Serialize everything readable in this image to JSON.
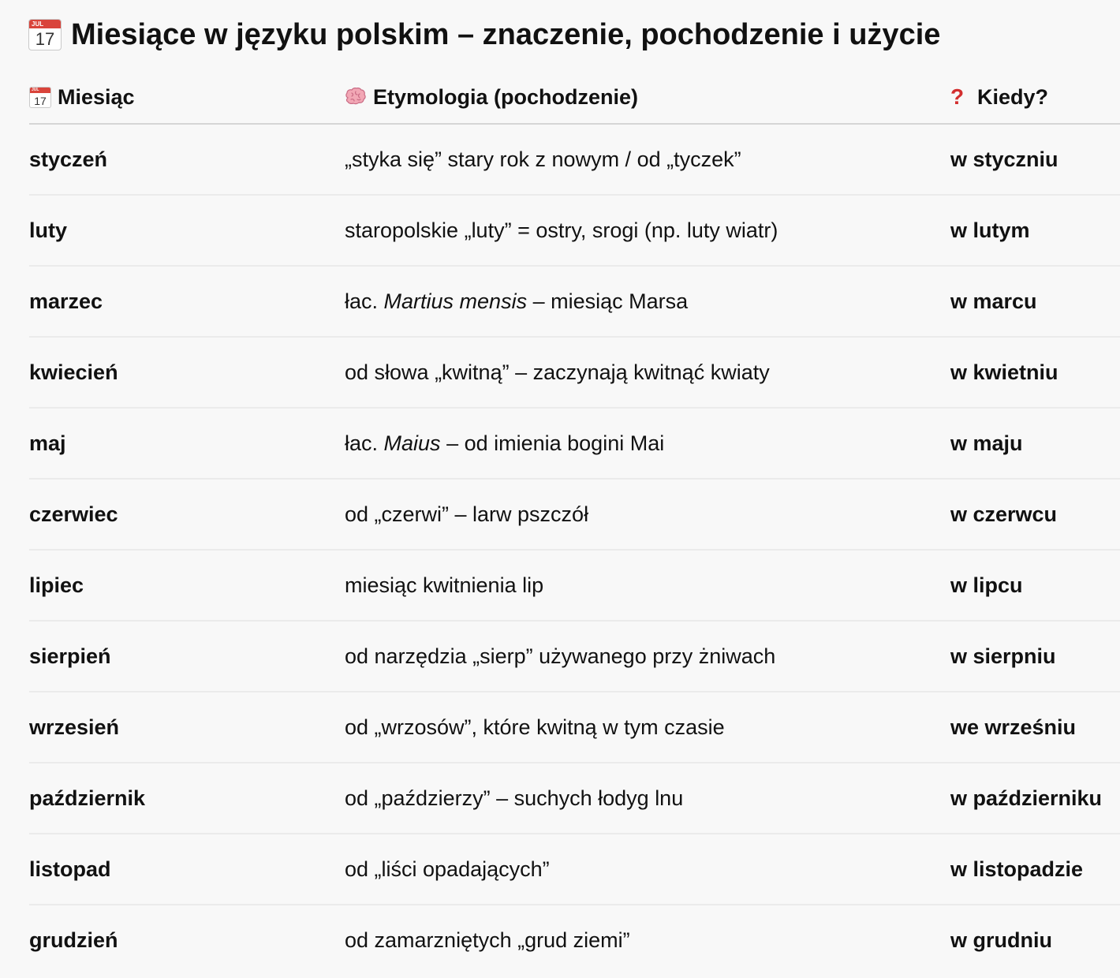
{
  "title": {
    "icon": "calendar-icon",
    "text": "Miesiące w języku polskim – znaczenie, pochodzenie i użycie",
    "calendar_month": "JUL",
    "calendar_day": "17"
  },
  "table": {
    "headers": [
      {
        "icon": "calendar-icon",
        "label": "Miesiąc"
      },
      {
        "icon": "brain-icon",
        "label": "Etymologia (pochodzenie)"
      },
      {
        "icon": "red-question-mark-icon",
        "label": "Kiedy?"
      }
    ],
    "rows": [
      {
        "month": "styczeń",
        "etymology": [
          {
            "text": "„styka się” stary rok z nowym / od „tyczek”"
          }
        ],
        "when": "w styczniu"
      },
      {
        "month": "luty",
        "etymology": [
          {
            "text": "staropolskie „luty” = ostry, srogi (np. luty wiatr)"
          }
        ],
        "when": "w lutym"
      },
      {
        "month": "marzec",
        "etymology": [
          {
            "text": "łac. "
          },
          {
            "text": "Martius mensis",
            "italic": true
          },
          {
            "text": " – miesiąc Marsa"
          }
        ],
        "when": "w marcu"
      },
      {
        "month": "kwiecień",
        "etymology": [
          {
            "text": "od słowa „kwitną” – zaczynają kwitnąć kwiaty"
          }
        ],
        "when": "w kwietniu"
      },
      {
        "month": "maj",
        "etymology": [
          {
            "text": "łac. "
          },
          {
            "text": "Maius",
            "italic": true
          },
          {
            "text": " – od imienia bogini Mai"
          }
        ],
        "when": "w maju"
      },
      {
        "month": "czerwiec",
        "etymology": [
          {
            "text": "od „czerwi” – larw pszczół"
          }
        ],
        "when": "w czerwcu"
      },
      {
        "month": "lipiec",
        "etymology": [
          {
            "text": "miesiąc kwitnienia lip"
          }
        ],
        "when": "w lipcu"
      },
      {
        "month": "sierpień",
        "etymology": [
          {
            "text": "od narzędzia „sierp” używanego przy żniwach"
          }
        ],
        "when": "w sierpniu"
      },
      {
        "month": "wrzesień",
        "etymology": [
          {
            "text": "od „wrzosów”, które kwitną w tym czasie"
          }
        ],
        "when": "we wrześniu"
      },
      {
        "month": "październik",
        "etymology": [
          {
            "text": "od „paździerzy” – suchych łodyg lnu"
          }
        ],
        "when": "w październiku"
      },
      {
        "month": "listopad",
        "etymology": [
          {
            "text": "od „liści opadających”"
          }
        ],
        "when": "w listopadzie"
      },
      {
        "month": "grudzień",
        "etymology": [
          {
            "text": "od zamarzniętych „grud ziemi”"
          }
        ],
        "when": "w grudniu"
      }
    ]
  },
  "colors": {
    "background": "#f8f8f8",
    "text": "#111111",
    "header_border": "#d6d6d6",
    "row_border": "#ebebeb",
    "calendar_red": "#d9443b",
    "question_red": "#d32f2f",
    "brain_pink": "#f2a7b5"
  }
}
